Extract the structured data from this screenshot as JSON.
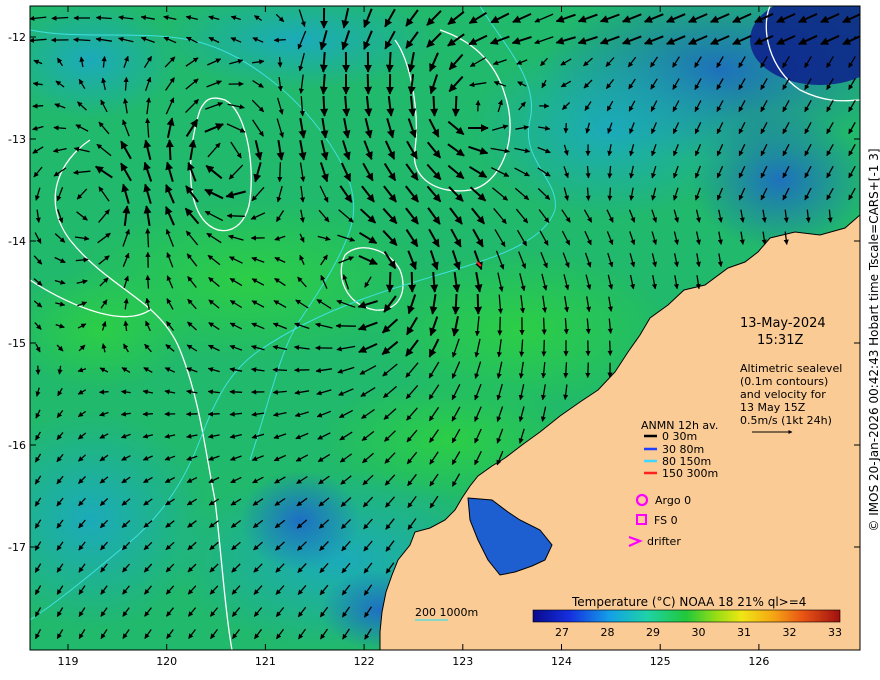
{
  "map": {
    "lat_ticks": [
      "-12",
      "-13",
      "-14",
      "-15",
      "-16",
      "-17"
    ],
    "lon_ticks": [
      "119",
      "120",
      "121",
      "122",
      "123",
      "124",
      "125",
      "126"
    ]
  },
  "info": {
    "date": "13-May-2024",
    "time": "15:31Z",
    "desc_lines": [
      "Altimetric sealevel",
      "(0.1m contours)",
      "and velocity for",
      "13 May 15Z",
      "0.5m/s (1kt 24h)"
    ]
  },
  "legend": {
    "title": "ANMN 12h av.",
    "items": [
      {
        "label": "0 30m",
        "color": "#000000"
      },
      {
        "label": "30 80m",
        "color": "#1f3fff"
      },
      {
        "label": "80 150m",
        "color": "#3fd6ff"
      },
      {
        "label": "150 300m",
        "color": "#ff2020"
      }
    ],
    "argo": "Argo 0",
    "fs": "FS 0",
    "drifter": "drifter",
    "marker_color": "#ff00ff"
  },
  "bathy_label": "200  1000m",
  "colorbar": {
    "title": "Temperature (°C) NOAA 18 21% ql>=4",
    "ticks": [
      "27",
      "28",
      "29",
      "30",
      "31",
      "32",
      "33"
    ]
  },
  "credit": "© IMOS 20-Jan-2026 00:42:43 Hobart time Tscale=CARS+[-1 3]",
  "colors": {
    "land": "#fbcb96",
    "sea_main": "#21b96b",
    "sea_green": "#2ed23f",
    "sea_cyan": "#26a9b5",
    "sea_blue": "#1d5fd0",
    "deep_blue": "#0d1f8c",
    "contour": "#ffffff",
    "isobath": "#40e0e0"
  }
}
